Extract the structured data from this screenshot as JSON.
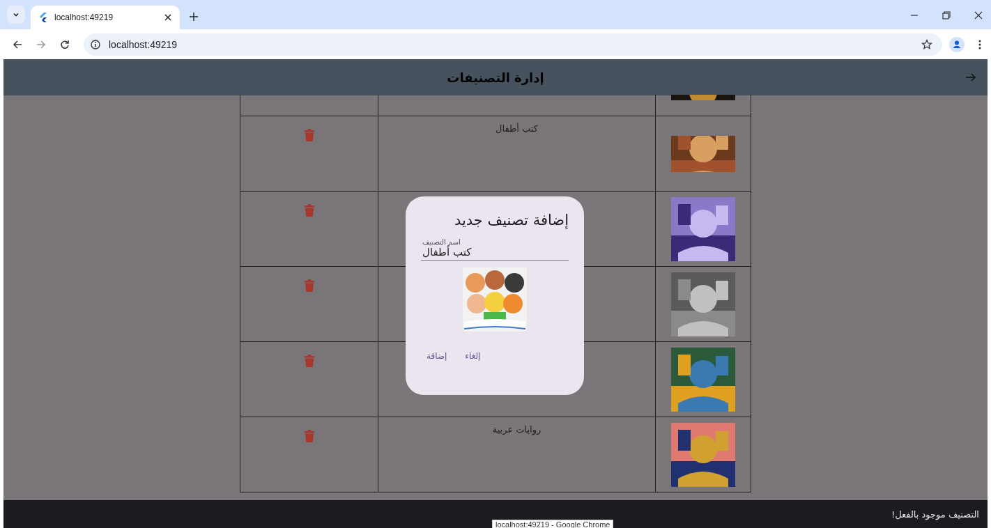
{
  "browser": {
    "tab_title": "localhost:49219",
    "address": "localhost:49219"
  },
  "app_bar": {
    "title": "إدارة التصنيفات"
  },
  "table": {
    "rows": [
      {
        "cut_off": true
      },
      {
        "cut_off": false,
        "name": "كتب أطفال"
      },
      {
        "cut_off": false
      },
      {
        "cut_off": false
      },
      {
        "cut_off": false
      },
      {
        "cut_off": false,
        "name": "روايات عربية"
      }
    ]
  },
  "dialog": {
    "title": "إضافة تصنيف جديد",
    "field": {
      "label": "اسم التصنيف",
      "value": "كتب أطفال"
    },
    "buttons": [
      "إلغاء",
      "إضافة"
    ]
  },
  "snackbar": {
    "message": "التصنيف موجود بالفعل!"
  },
  "tooltip": {
    "text": "localhost:49219 - Google Chrome"
  }
}
